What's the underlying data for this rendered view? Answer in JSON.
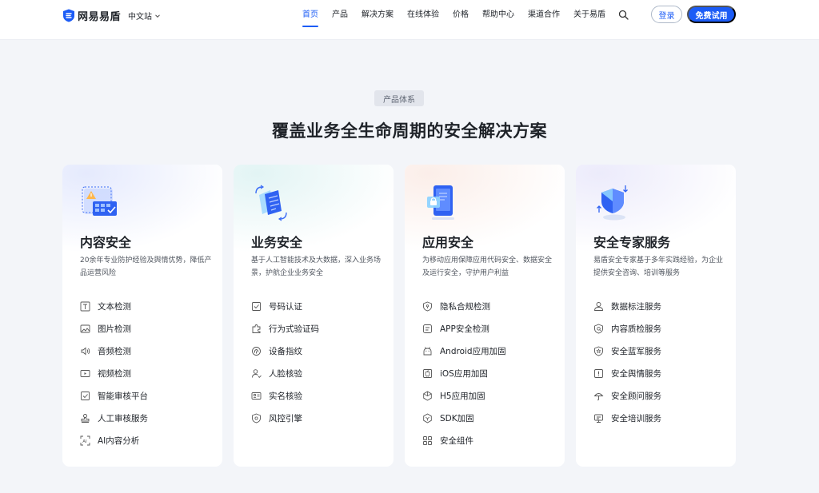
{
  "brand": {
    "name": "网易易盾"
  },
  "header": {
    "site_select": "中文站",
    "nav": [
      {
        "label": "首页",
        "active": true
      },
      {
        "label": "产品",
        "active": false
      },
      {
        "label": "解决方案",
        "active": false
      },
      {
        "label": "在线体验",
        "active": false
      },
      {
        "label": "价格",
        "active": false
      },
      {
        "label": "帮助中心",
        "active": false
      },
      {
        "label": "渠道合作",
        "active": false
      },
      {
        "label": "关于易盾",
        "active": false
      }
    ],
    "login_label": "登录",
    "trial_label": "免费试用"
  },
  "section": {
    "tag": "产品体系",
    "title": "覆盖业务全生命周期的安全解决方案"
  },
  "colors": {
    "accent": "#1c5cf6",
    "text": "#1f2329",
    "muted": "#50565f"
  },
  "cards": [
    {
      "title": "内容安全",
      "desc": "20余年专业防护经验及舆情优势，降低产品运营风险",
      "hero_icon": "content-security-illustration",
      "items": [
        {
          "label": "文本检测",
          "icon": "text-icon"
        },
        {
          "label": "图片检测",
          "icon": "image-icon"
        },
        {
          "label": "音频检测",
          "icon": "audio-icon"
        },
        {
          "label": "视频检测",
          "icon": "video-icon"
        },
        {
          "label": "智能审核平台",
          "icon": "check-board-icon"
        },
        {
          "label": "人工审核服务",
          "icon": "stamp-icon"
        },
        {
          "label": "AI内容分析",
          "icon": "ai-scan-icon"
        }
      ]
    },
    {
      "title": "业务安全",
      "desc": "基于人工智能技术及大数据，深入业务场景，护航企业业务安全",
      "hero_icon": "business-security-illustration",
      "items": [
        {
          "label": "号码认证",
          "icon": "number-check-icon"
        },
        {
          "label": "行为式验证码",
          "icon": "puzzle-icon"
        },
        {
          "label": "设备指纹",
          "icon": "fingerprint-icon"
        },
        {
          "label": "人脸核验",
          "icon": "face-user-icon"
        },
        {
          "label": "实名核验",
          "icon": "id-card-icon"
        },
        {
          "label": "风控引擎",
          "icon": "shield-engine-icon"
        }
      ]
    },
    {
      "title": "应用安全",
      "desc": "为移动应用保障应用代码安全、数据安全及运行安全，守护用户利益",
      "hero_icon": "app-security-illustration",
      "items": [
        {
          "label": "隐私合规检测",
          "icon": "privacy-shield-icon"
        },
        {
          "label": "APP安全检测",
          "icon": "app-icon"
        },
        {
          "label": "Android应用加固",
          "icon": "android-icon"
        },
        {
          "label": "iOS应用加固",
          "icon": "apple-icon"
        },
        {
          "label": "H5应用加固",
          "icon": "h5-hexagon-icon"
        },
        {
          "label": "SDK加固",
          "icon": "sdk-hexagon-icon"
        },
        {
          "label": "安全组件",
          "icon": "components-grid-icon"
        }
      ]
    },
    {
      "title": "安全专家服务",
      "desc": "易盾安全专家基于多年实践经验，为企业提供安全咨询、培训等服务",
      "hero_icon": "expert-service-illustration",
      "items": [
        {
          "label": "数据标注服务",
          "icon": "user-tag-icon"
        },
        {
          "label": "内容质检服务",
          "icon": "quality-badge-icon"
        },
        {
          "label": "安全蓝军服务",
          "icon": "star-shield-icon"
        },
        {
          "label": "安全舆情服务",
          "icon": "alert-icon"
        },
        {
          "label": "安全顾问服务",
          "icon": "umbrella-icon"
        },
        {
          "label": "安全培训服务",
          "icon": "training-screen-icon"
        }
      ]
    }
  ]
}
